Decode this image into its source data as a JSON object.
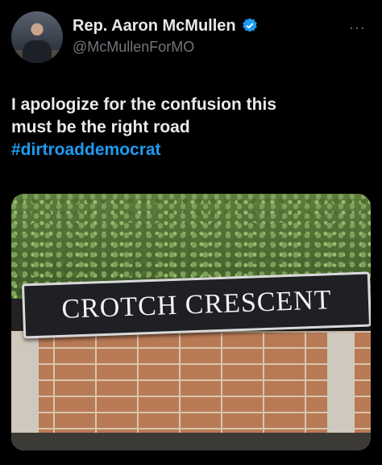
{
  "author": {
    "display_name": "Rep. Aaron McMullen",
    "handle": "@McMullenForMO",
    "verified_color": "#1d9bf0"
  },
  "more_menu": "···",
  "tweet": {
    "line1": "I apologize for the confusion this",
    "line2": "must be the right road",
    "hashtag": "#dirtroaddemocrat"
  },
  "photo": {
    "sign_text": "CROTCH  CRESCENT"
  }
}
